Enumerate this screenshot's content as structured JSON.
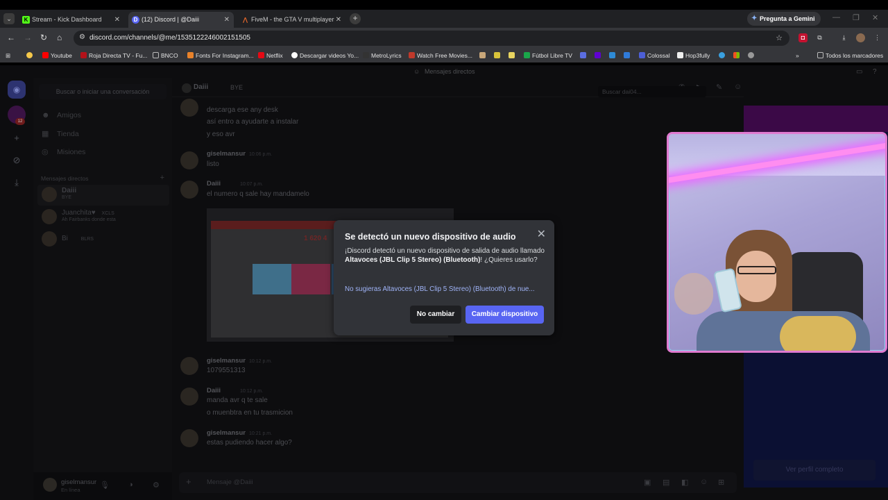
{
  "browser": {
    "tabs": [
      {
        "title": "Stream - Kick Dashboard",
        "favicon": "K",
        "color": "#53fc18"
      },
      {
        "title": "(12) Discord | @Daiii",
        "favicon": "D",
        "color": "#5865f2"
      },
      {
        "title": "FiveM - the GTA V multiplayer",
        "favicon": "F",
        "color": "#f26c2b"
      }
    ],
    "gemini_label": "Pregunta a Gemini",
    "url": "discord.com/channels/@me/1535122246002151505",
    "bookmarks": [
      {
        "label": "Youtube",
        "color": "#ff0000"
      },
      {
        "label": "Roja Directa TV - Fu...",
        "color": "#b3121a"
      },
      {
        "label": "BNCO",
        "color": "#888888"
      },
      {
        "label": "Fonts For Instagram...",
        "color": "#e8822a"
      },
      {
        "label": "Netflix",
        "color": "#e50914"
      },
      {
        "label": "Descargar videos Yo...",
        "color": "#ffffff"
      },
      {
        "label": "MetroLyrics",
        "color": "#333333"
      },
      {
        "label": "Watch Free Movies...",
        "color": "#c0392b"
      },
      {
        "label": "Fútbol Libre TV",
        "color": "#1aa64a"
      },
      {
        "label": "Colossal",
        "color": "#4d5fd6"
      },
      {
        "label": "Hop3fully",
        "color": "#eeeeee"
      }
    ],
    "all_bookmarks": "Todos los marcadores"
  },
  "discord": {
    "window_title": "Mensajes directos",
    "sidebar": {
      "search_placeholder": "Buscar o iniciar una conversación",
      "nav": [
        "Amigos",
        "Tienda",
        "Misiones"
      ],
      "dm_header": "Mensajes directos",
      "dms": [
        {
          "name": "Daiii",
          "status": "BYE"
        },
        {
          "name": "Juanchita♥",
          "tag": "XCLS",
          "status": "Ah Fairbanks donde esta"
        },
        {
          "name": "Bi",
          "tag": "BLRS",
          "status": ""
        }
      ],
      "guild_badge": "12",
      "user": {
        "name": "giselmansur",
        "status": "En línea"
      }
    },
    "chat": {
      "header_name": "Daiii",
      "header_status": "BYE",
      "search_placeholder": "Buscar dai04...",
      "lines_top": [
        "descarga ese any desk",
        "así entro a ayudarte a instalar",
        "y eso avr"
      ],
      "messages": [
        {
          "author": "giselmansur",
          "time": "10:06 p.m.",
          "text": "listo"
        },
        {
          "author": "Daiii",
          "time": "10:07 p.m.",
          "text": "el numero q sale hay mandamelo"
        },
        {
          "author": "giselmansur",
          "time": "10:12 p.m.",
          "text": "1079551313"
        },
        {
          "author": "Daiii",
          "time": "10:12 p.m.",
          "text": "manda avr q te sale",
          "text2": "o muenbtra en tu trasmicion"
        },
        {
          "author": "giselmansur",
          "time": "10:21 p.m.",
          "text": "estas pudiendo hacer algo?"
        }
      ],
      "screenshot_number": "1 620 4",
      "composer_placeholder": "Mensaje @Daiii"
    },
    "profile_button": "Ver perfil completo"
  },
  "modal": {
    "title": "Se detectó un nuevo dispositivo de audio",
    "body_prefix": "¡Discord detectó un nuevo dispositivo de salida de audio llamado ",
    "device": "Altavoces (JBL Clip 5 Stereo) (Bluetooth)",
    "body_suffix": "! ¿Quieres usarlo?",
    "link": "No sugieras Altavoces (JBL Clip 5 Stereo) (Bluetooth) de nue...",
    "btn_keep": "No cambiar",
    "btn_switch": "Cambiar dispositivo"
  },
  "colors": {
    "accent": "#5865f2",
    "cam_border": "#e07ad0"
  }
}
